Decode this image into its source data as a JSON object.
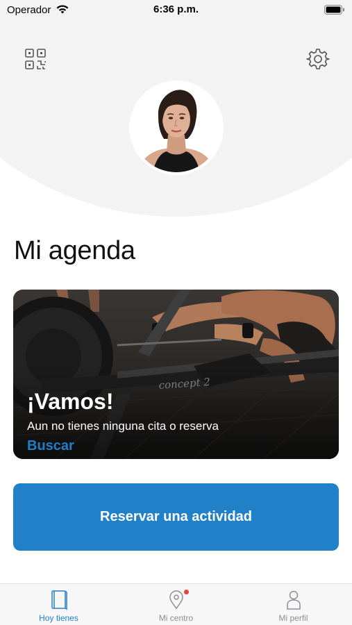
{
  "status_bar": {
    "carrier": "Operador",
    "time": "6:36 p.m."
  },
  "header": {
    "qr_icon": "qr-code-icon",
    "settings_icon": "gear-icon",
    "avatar": "profile-photo"
  },
  "main": {
    "title": "Mi agenda",
    "card": {
      "title": "¡Vamos!",
      "text": "Aun no tienes ninguna cita o reserva",
      "link": "Buscar"
    },
    "reserve_button": "Reservar una actividad"
  },
  "tabs": [
    {
      "label": "Hoy tienes",
      "icon": "book-icon",
      "active": true
    },
    {
      "label": "Mi centro",
      "icon": "location-pin-icon",
      "active": false,
      "badge": true
    },
    {
      "label": "Mi perfil",
      "icon": "person-icon",
      "active": false
    }
  ],
  "colors": {
    "accent": "#2181c8",
    "badge": "#e8453c",
    "header_bg": "#f3f3f3"
  }
}
